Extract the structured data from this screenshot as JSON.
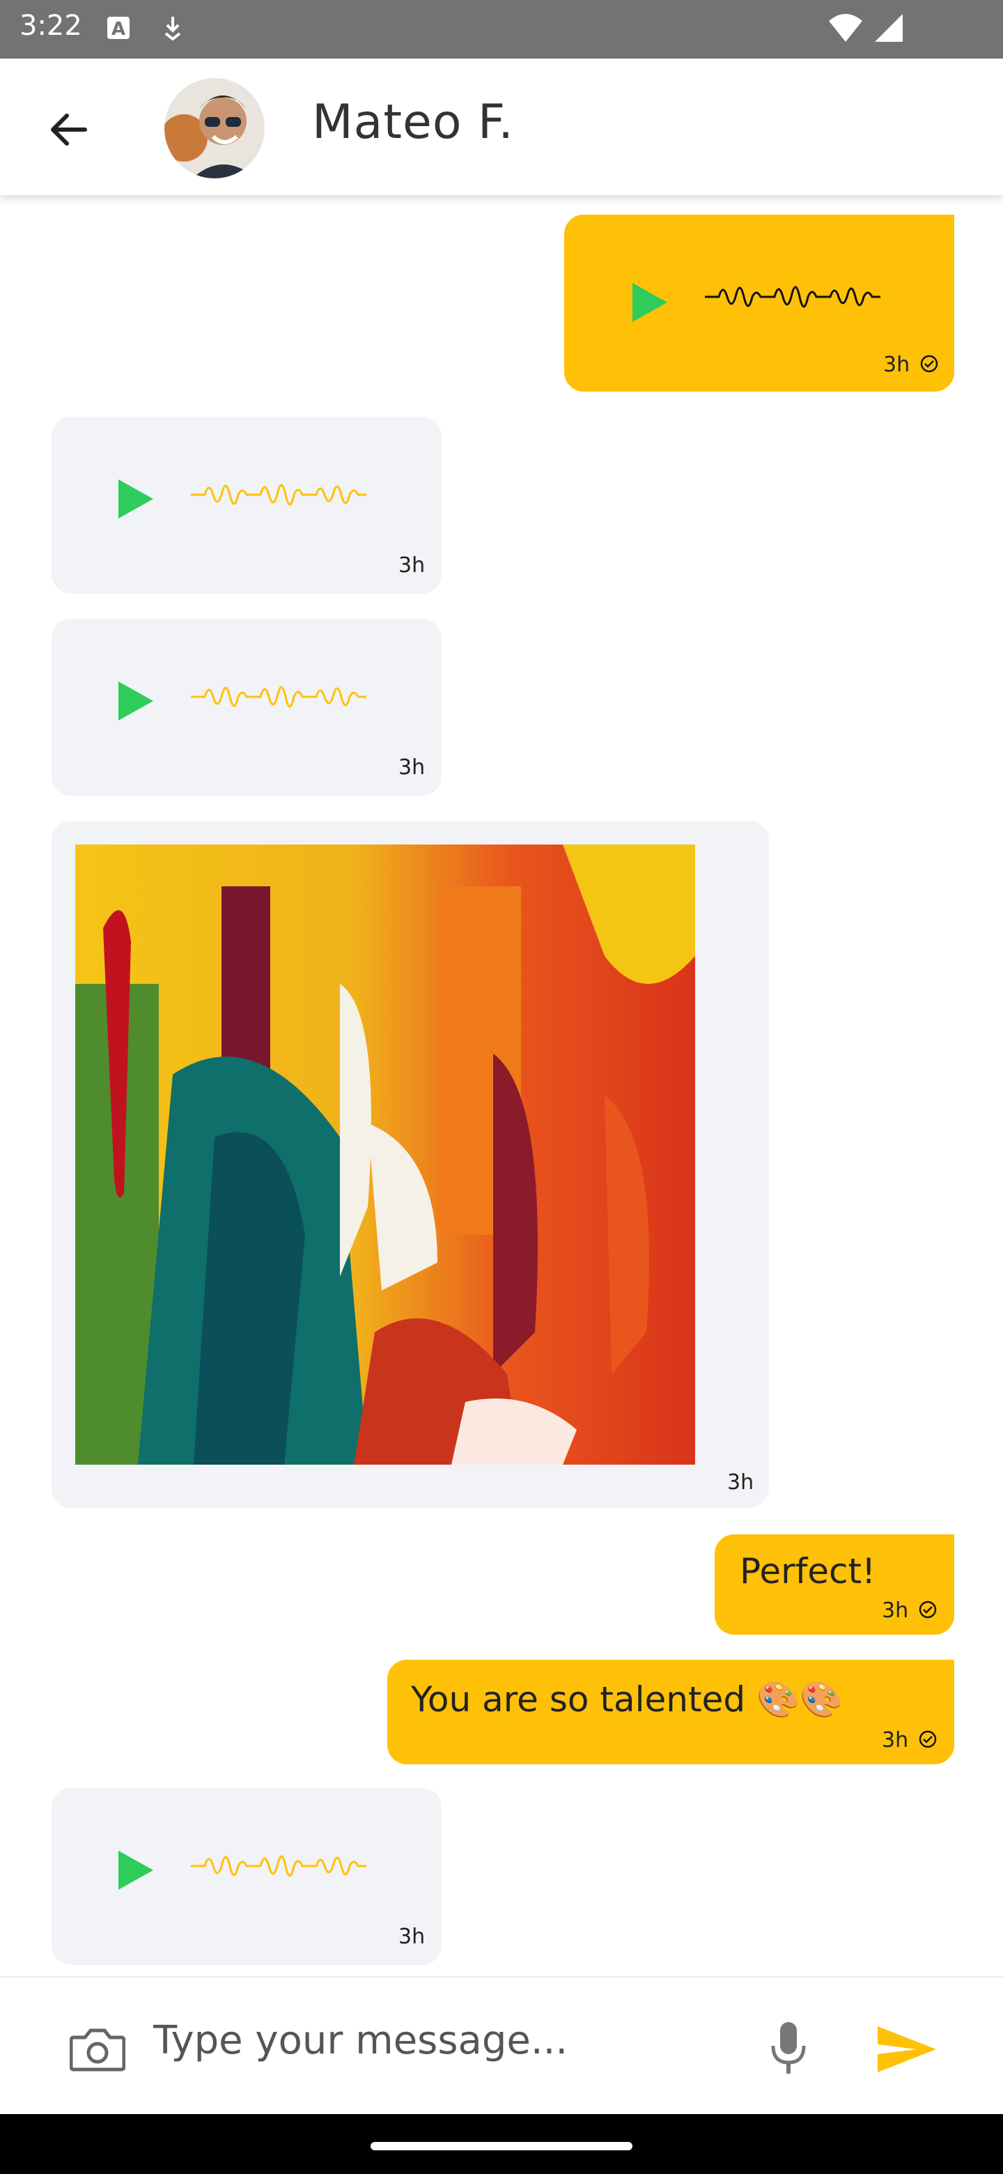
{
  "status_bar": {
    "time": "3:22"
  },
  "header": {
    "contact_name": "Mateo F."
  },
  "messages": [
    {
      "type": "audio",
      "direction": "outgoing",
      "time": "3h",
      "read": true
    },
    {
      "type": "audio",
      "direction": "incoming",
      "time": "3h"
    },
    {
      "type": "audio",
      "direction": "incoming",
      "time": "3h"
    },
    {
      "type": "image",
      "direction": "incoming",
      "time": "3h"
    },
    {
      "type": "text",
      "direction": "outgoing",
      "text": "Perfect!",
      "time": "3h",
      "read": true
    },
    {
      "type": "text",
      "direction": "outgoing",
      "text": "You are so talented 🎨🎨",
      "time": "3h",
      "read": true
    },
    {
      "type": "audio",
      "direction": "incoming",
      "time": "3h"
    }
  ],
  "composer": {
    "placeholder": "Type your message..."
  },
  "colors": {
    "accent": "#ffc107",
    "play": "#2ecc5a",
    "incoming_bg": "#f2f3f6",
    "status_bar": "#737373"
  },
  "icons": [
    "back-arrow-icon",
    "camera-icon",
    "microphone-icon",
    "send-icon",
    "play-icon",
    "waveform-icon",
    "check-icon",
    "wifi-icon",
    "signal-icon"
  ]
}
